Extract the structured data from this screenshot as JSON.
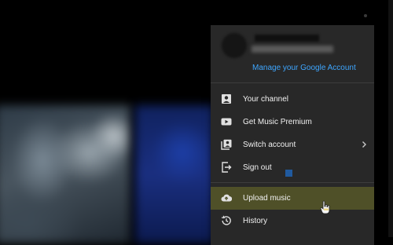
{
  "account_menu": {
    "manage_account_label": "Manage your Google Account",
    "items": [
      {
        "label": "Your channel",
        "icon": "account-box-icon"
      },
      {
        "label": "Get Music Premium",
        "icon": "youtube-play-icon"
      },
      {
        "label": "Switch account",
        "icon": "switch-account-icon"
      },
      {
        "label": "Sign out",
        "icon": "sign-out-icon"
      }
    ],
    "items_secondary": [
      {
        "label": "Upload music",
        "icon": "cloud-upload-icon",
        "highlighted": true
      },
      {
        "label": "History",
        "icon": "history-icon"
      }
    ]
  },
  "colors": {
    "menu_background": "#282828",
    "link": "#3ea6ff",
    "highlight": "#4f5028",
    "text": "#f1f1f1"
  }
}
